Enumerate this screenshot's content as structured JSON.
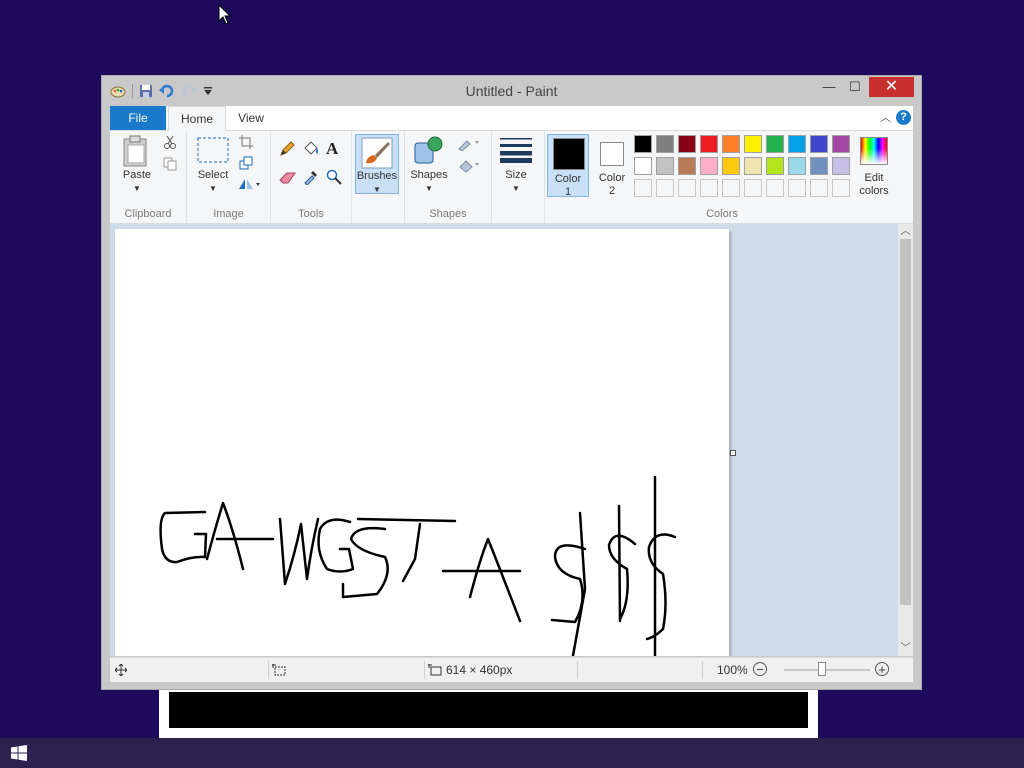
{
  "window": {
    "title": "Untitled - Paint",
    "minimize": "—",
    "maximize": "☐",
    "close": "✕"
  },
  "menu": {
    "file": "File",
    "home": "Home",
    "view": "View",
    "help": "?"
  },
  "ribbon": {
    "paste": "Paste",
    "select": "Select",
    "brushes": "Brushes",
    "shapes": "Shapes",
    "size": "Size",
    "color1_line1": "Color",
    "color1_line2": "1",
    "color2_line1": "Color",
    "color2_line2": "2",
    "edit_colors_line1": "Edit",
    "edit_colors_line2": "colors",
    "groups": {
      "clipboard": "Clipboard",
      "image": "Image",
      "tools": "Tools",
      "shapes": "Shapes",
      "colors": "Colors"
    }
  },
  "colors": {
    "color1": "#000000",
    "color2": "#ffffff",
    "palette_row1": [
      "#000000",
      "#7f7f7f",
      "#880015",
      "#ed1c24",
      "#ff7f27",
      "#fff200",
      "#22b14c",
      "#00a2e8",
      "#3f48cc",
      "#a349a4"
    ],
    "palette_row2": [
      "#ffffff",
      "#c3c3c3",
      "#b97a57",
      "#ffaec9",
      "#ffc90e",
      "#efe4b0",
      "#b5e61d",
      "#99d9ea",
      "#7092be",
      "#c8bfe7"
    ],
    "palette_row3": [
      "#f5f6f7",
      "#f5f6f7",
      "#f5f6f7",
      "#f5f6f7",
      "#f5f6f7",
      "#f5f6f7",
      "#f5f6f7",
      "#f5f6f7",
      "#f5f6f7",
      "#f5f6f7"
    ],
    "desktop_bg": "#1e0a5c",
    "ribbon_accent": "#1979ca"
  },
  "status": {
    "canvas_size": "614 × 460px",
    "zoom": "100%"
  },
  "icons": {
    "app": "paint-app-icon",
    "save": "save-icon",
    "undo": "undo-icon",
    "redo": "redo-icon",
    "start": "windows-start-icon"
  }
}
